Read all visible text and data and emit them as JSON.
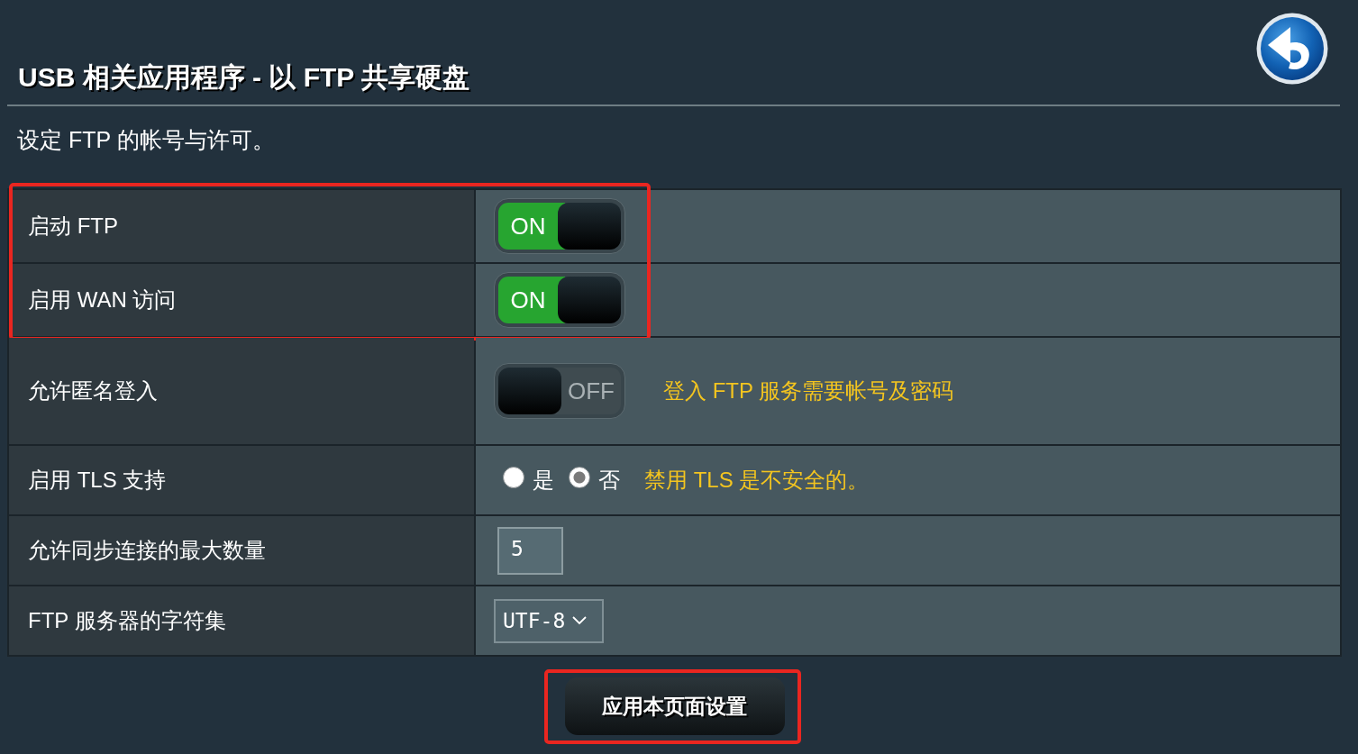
{
  "page": {
    "title": "USB 相关应用程序 - 以 FTP 共享硬盘",
    "description": "设定 FTP 的帐号与许可。"
  },
  "settings": [
    {
      "label": "启动 FTP",
      "kind": "toggle",
      "on": true,
      "state_text": "ON",
      "highlighted": true
    },
    {
      "label": "启用 WAN 访问",
      "kind": "toggle",
      "on": true,
      "state_text": "ON",
      "highlighted": true
    },
    {
      "label": "允许匿名登入",
      "kind": "toggle",
      "on": false,
      "state_text": "OFF",
      "hint": "登入 FTP 服务需要帐号及密码",
      "highlighted": false
    },
    {
      "label": "启用 TLS 支持",
      "kind": "radio",
      "options": [
        {
          "label": "是",
          "selected": false
        },
        {
          "label": "否",
          "selected": true
        }
      ],
      "hint": "禁用 TLS 是不安全的。",
      "highlighted": false
    },
    {
      "label": "允许同步连接的最大数量",
      "kind": "number",
      "value": "5",
      "highlighted": false
    },
    {
      "label": "FTP 服务器的字符集",
      "kind": "select",
      "value": "UTF-8",
      "highlighted": false
    }
  ],
  "apply_button": {
    "label": "应用本页面设置",
    "highlighted": true
  }
}
